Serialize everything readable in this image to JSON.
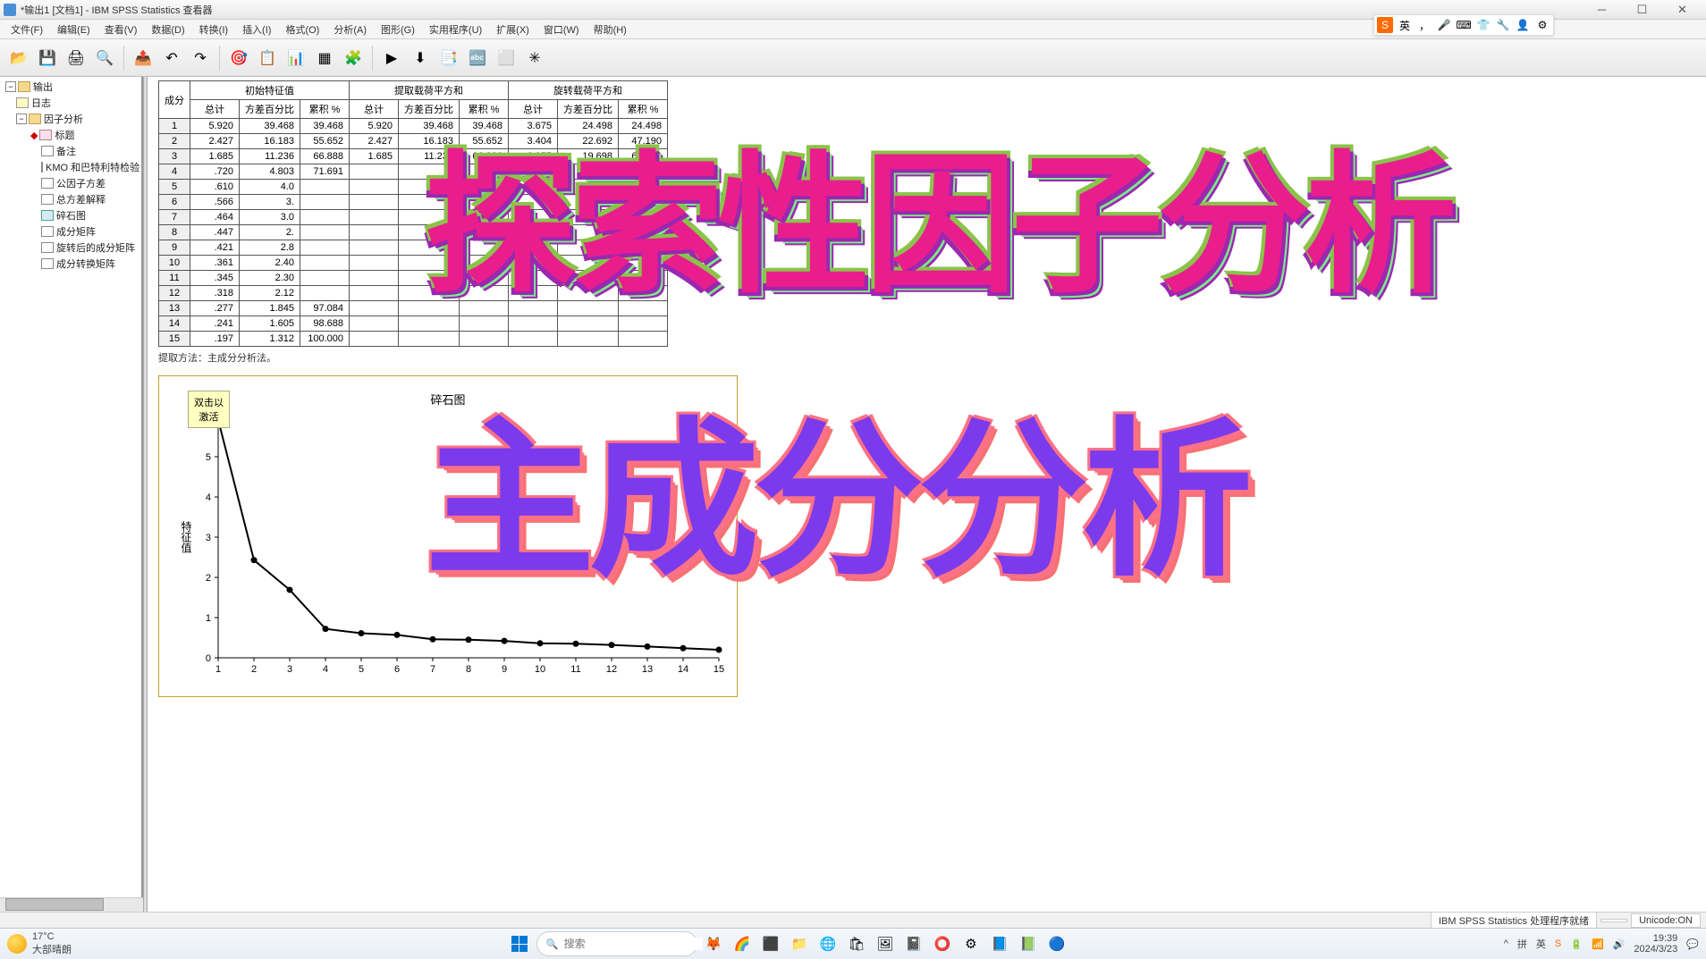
{
  "window": {
    "title": "*输出1 [文档1] - IBM SPSS Statistics 查看器"
  },
  "menu": {
    "items": [
      "文件(F)",
      "编辑(E)",
      "查看(V)",
      "数据(D)",
      "转换(I)",
      "插入(I)",
      "格式(O)",
      "分析(A)",
      "图形(G)",
      "实用程序(U)",
      "扩展(X)",
      "窗口(W)",
      "帮助(H)"
    ]
  },
  "toolbar": {
    "open": "📂",
    "save": "💾",
    "print": "🖨",
    "preview": "🔍",
    "export": "📤",
    "undo": "↶",
    "redo": "↷",
    "goto": "🎯",
    "insert": "📋",
    "chart": "📊",
    "grid": "▦",
    "pivot": "🧩",
    "runsel": "▶",
    "run": "⬇",
    "dialog": "📑",
    "var": "🔤",
    "recent": "⬜",
    "plus": "✳"
  },
  "tree": {
    "root": "输出",
    "log": "日志",
    "factor": "因子分析",
    "title": "标题",
    "note": "备注",
    "kmo": "KMO 和巴特利特检验",
    "communal": "公因子方差",
    "totalvar": "总方差解释",
    "scree": "碎石图",
    "compmat": "成分矩阵",
    "rotmat": "旋转后的成分矩阵",
    "transmat": "成分转换矩阵"
  },
  "table": {
    "hdr_group": [
      "初始特征值",
      "提取载荷平方和",
      "旋转载荷平方和"
    ],
    "hdr_sub": [
      "成分",
      "总计",
      "方差百分比",
      "累积 %",
      "总计",
      "方差百分比",
      "累积 %",
      "总计",
      "方差百分比",
      "累积 %"
    ],
    "rows": [
      [
        "1",
        "5.920",
        "39.468",
        "39.468",
        "5.920",
        "39.468",
        "39.468",
        "3.675",
        "24.498",
        "24.498"
      ],
      [
        "2",
        "2.427",
        "16.183",
        "55.652",
        "2.427",
        "16.183",
        "55.652",
        "3.404",
        "22.692",
        "47.190"
      ],
      [
        "3",
        "1.685",
        "11.236",
        "66.888",
        "1.685",
        "11.236",
        "66.888",
        "2.955",
        "19.698",
        "66.888"
      ],
      [
        "4",
        ".720",
        "4.803",
        "71.691",
        "",
        "",
        "",
        "",
        "",
        ""
      ],
      [
        "5",
        ".610",
        "4.0",
        "",
        "",
        "",
        "",
        "",
        "",
        ""
      ],
      [
        "6",
        ".566",
        "3.",
        "",
        "",
        "",
        "",
        "",
        "",
        ""
      ],
      [
        "7",
        ".464",
        "3.0",
        "",
        "",
        "",
        "",
        "",
        "",
        ""
      ],
      [
        "8",
        ".447",
        "2.",
        "",
        "",
        "",
        "",
        "",
        "",
        ""
      ],
      [
        "9",
        ".421",
        "2.8",
        "",
        "",
        "",
        "",
        "",
        "",
        ""
      ],
      [
        "10",
        ".361",
        "2.40",
        "",
        "",
        "",
        "",
        "",
        "",
        ""
      ],
      [
        "11",
        ".345",
        "2.30",
        "",
        "",
        "",
        "",
        "",
        "",
        ""
      ],
      [
        "12",
        ".318",
        "2.12",
        "",
        "",
        "",
        "",
        "",
        "",
        ""
      ],
      [
        "13",
        ".277",
        "1.845",
        "97.084",
        "",
        "",
        "",
        "",
        "",
        ""
      ],
      [
        "14",
        ".241",
        "1.605",
        "98.688",
        "",
        "",
        "",
        "",
        "",
        ""
      ],
      [
        "15",
        ".197",
        "1.312",
        "100.000",
        "",
        "",
        "",
        "",
        "",
        ""
      ]
    ],
    "note": "提取方法：主成分分析法。"
  },
  "chart_data": {
    "type": "line",
    "title": "碎石图",
    "ylabel": "特征值",
    "hint": "双击以\n激活",
    "x": [
      1,
      2,
      3,
      4,
      5,
      6,
      7,
      8,
      9,
      10,
      11,
      12,
      13,
      14,
      15
    ],
    "values": [
      5.92,
      2.43,
      1.69,
      0.72,
      0.61,
      0.57,
      0.46,
      0.45,
      0.42,
      0.36,
      0.35,
      0.32,
      0.28,
      0.24,
      0.2
    ],
    "ylim": [
      0,
      6
    ],
    "yticks": [
      0,
      1,
      2,
      3,
      4,
      5
    ]
  },
  "overlay": {
    "t1": "探索性因子分析",
    "t2": "主成分分析"
  },
  "status": {
    "proc": "IBM SPSS Statistics 处理程序就绪",
    "unicode": "Unicode:ON"
  },
  "taskbar": {
    "weather_temp": "17°C",
    "weather_desc": "大部晴朗",
    "search_ph": "搜索",
    "time": "19:39",
    "date": "2024/3/23",
    "ime_lang": "英",
    "ime_punct": "，"
  }
}
